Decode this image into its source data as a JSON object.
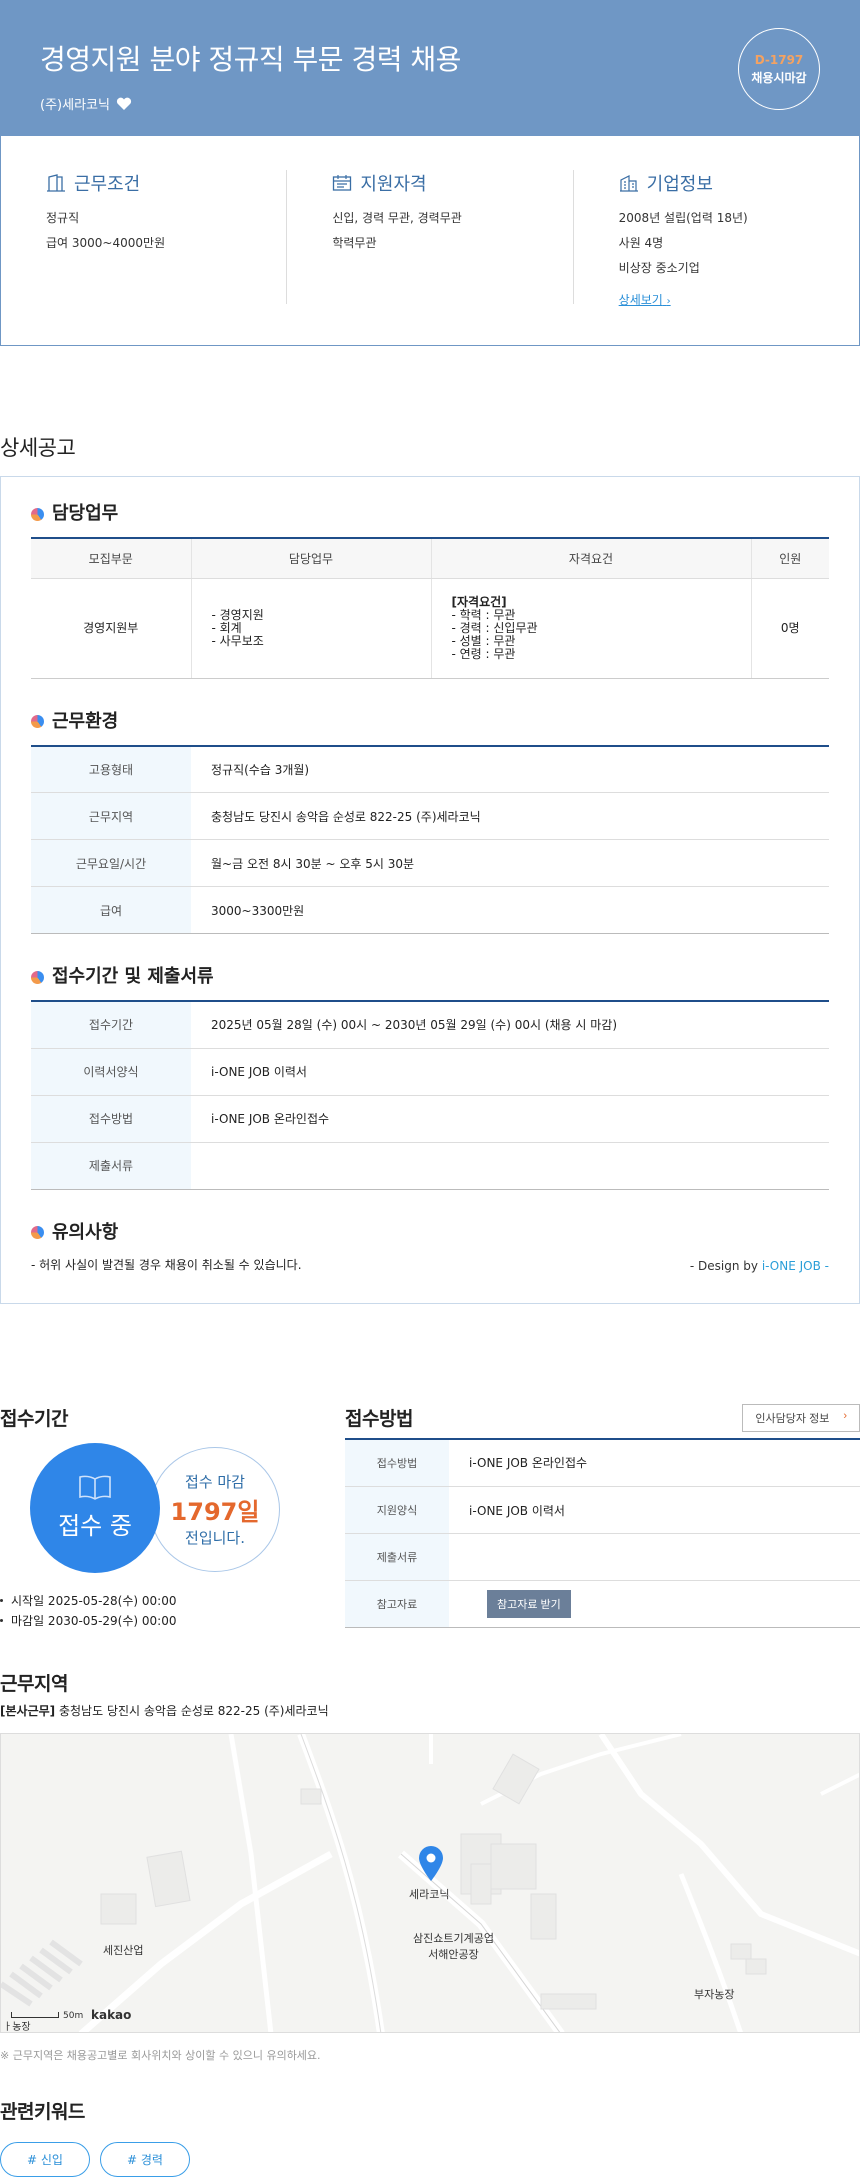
{
  "header": {
    "title": "경영지원 분야 정규직 부문 경력 채용",
    "company": "(주)세라코닉",
    "dday": "D-1797",
    "dday_label": "채용시마감"
  },
  "summary": {
    "work": {
      "title": "근무조건",
      "lines": [
        "정규직",
        "급여 3000~4000만원"
      ]
    },
    "qual": {
      "title": "지원자격",
      "lines": [
        "신입, 경력 무관, 경력무관",
        "학력무관"
      ]
    },
    "company": {
      "title": "기업정보",
      "lines": [
        "2008년 설립(업력 18년)",
        "사원 4명",
        "비상장 중소기업"
      ],
      "link": "상세보기"
    }
  },
  "detail": {
    "section_title": "상세공고",
    "duty": {
      "title": "담당업무",
      "headers": [
        "모집부문",
        "담당업무",
        "자격요건",
        "인원"
      ],
      "dept": "경영지원부",
      "tasks": [
        "- 경영지원",
        "- 회계",
        "- 사무보조"
      ],
      "req_title": "[자격요건]",
      "reqs": [
        "- 학력 : 무관",
        "- 경력 : 신입무관",
        "- 성별 : 무관",
        "- 연령 : 무관"
      ],
      "count": "0명"
    },
    "env": {
      "title": "근무환경",
      "rows": [
        {
          "k": "고용형태",
          "v": "정규직(수습 3개월)"
        },
        {
          "k": "근무지역",
          "v": "충청남도 당진시 송악읍 순성로 822-25 (주)세라코닉"
        },
        {
          "k": "근무요일/시간",
          "v": "월~금 오전 8시 30분 ~ 오후 5시 30분"
        },
        {
          "k": "급여",
          "v": "3000~3300만원"
        }
      ]
    },
    "apply": {
      "title": "접수기간 및 제출서류",
      "rows": [
        {
          "k": "접수기간",
          "v": "2025년 05월 28일 (수) 00시 ~ 2030년 05월 29일 (수) 00시 (채용 시 마감)"
        },
        {
          "k": "이력서양식",
          "v": "i-ONE JOB 이력서"
        },
        {
          "k": "접수방법",
          "v": "i-ONE JOB 온라인접수"
        },
        {
          "k": "제출서류",
          "v": ""
        }
      ]
    },
    "notice": {
      "title": "유의사항",
      "text": "- 허위 사실이 발견될 경우 채용이 취소될 수 있습니다.",
      "design_prefix": "- Design by ",
      "design_brand": "i-ONE JOB -"
    }
  },
  "period": {
    "title": "접수기간",
    "status": "접수 중",
    "close_label": "접수 마감",
    "days": "1797일",
    "suffix": "전입니다.",
    "start": "시작일 2025-05-28(수) 00:00",
    "end": "마감일 2030-05-29(수) 00:00"
  },
  "method": {
    "title": "접수방법",
    "hr_button": "인사담당자 정보",
    "hr_arrow": "›",
    "rows": [
      {
        "k": "접수방법",
        "v": "i-ONE JOB 온라인접수"
      },
      {
        "k": "지원양식",
        "v": "i-ONE JOB 이력서"
      },
      {
        "k": "제출서류",
        "v": ""
      },
      {
        "k": "참고자료",
        "v": ""
      }
    ],
    "ref_button": "참고자료 받기"
  },
  "location": {
    "title": "근무지역",
    "tag": "[본사근무]",
    "address": "충청남도 당진시 송악읍 순성로 822-25 (주)세라코닉",
    "map_labels": {
      "main": "세라코닉",
      "a": "세진산업",
      "b1": "삼진쇼트기계공업",
      "b2": "서해안공장",
      "c": "부자농장",
      "scale": "50m",
      "brand": "kakao",
      "edge": "ㅏ농장"
    },
    "note": "※ 근무지역은 채용공고별로 회사위치와 상이할 수 있으니 유의하세요."
  },
  "keywords": {
    "title": "관련키워드",
    "tags": [
      "# 신입",
      "# 경력"
    ]
  },
  "colors": {
    "header_bg": "#6f97c5",
    "accent_blue": "#2f86e8",
    "accent_orange": "#e4682d",
    "table_line": "#1f4e8a"
  }
}
